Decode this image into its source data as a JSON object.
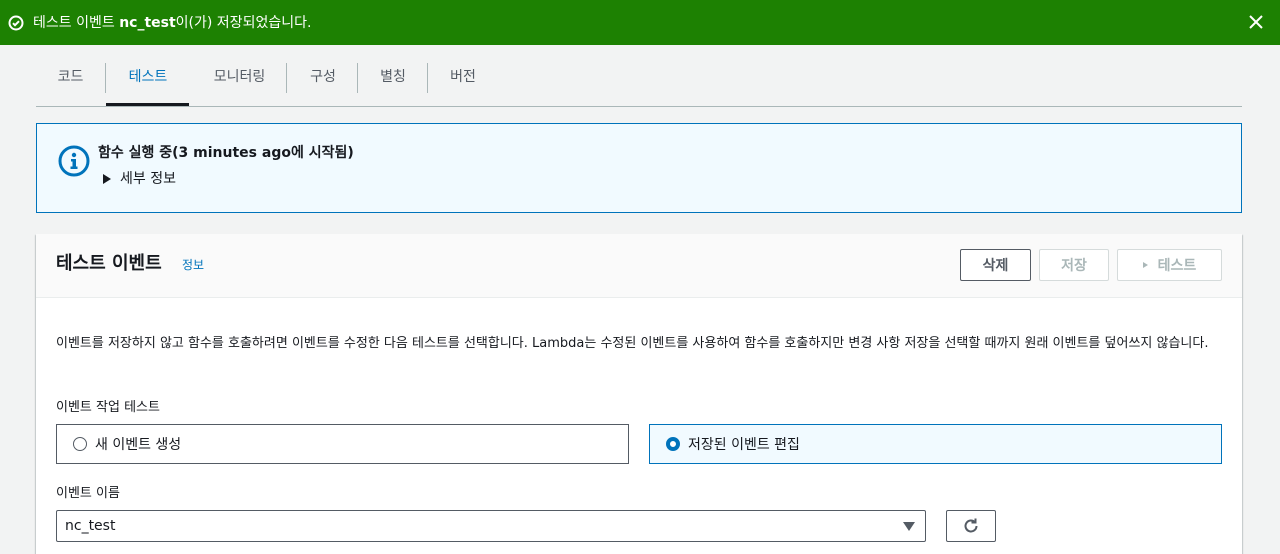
{
  "flash": {
    "prefix": "테스트 이벤트 ",
    "event_name": "nc_test",
    "suffix": "이(가) 저장되었습니다.",
    "color": "#1d8102"
  },
  "tabs": [
    {
      "label": "코드"
    },
    {
      "label": "테스트",
      "active": true
    },
    {
      "label": "모니터링"
    },
    {
      "label": "구성"
    },
    {
      "label": "별칭"
    },
    {
      "label": "버전"
    }
  ],
  "alert": {
    "title": "함수 실행 중(3 minutes ago에 시작됨)",
    "details_label": "세부 정보"
  },
  "panel": {
    "title": "테스트 이벤트",
    "info_link": "정보",
    "delete_button": "삭제",
    "save_button": "저장",
    "test_button": "테스트",
    "description": "이벤트를 저장하지 않고 함수를 호출하려면 이벤트를 수정한 다음 테스트를 선택합니다. Lambda는 수정된 이벤트를 사용하여 함수를 호출하지만 변경 사항 저장을 선택할 때까지 원래 이벤트를 덮어쓰지 않습니다.",
    "action_label": "이벤트 작업 테스트",
    "option_new": "새 이벤트 생성",
    "option_edit": "저장된 이벤트 편집",
    "selected_option": "저장된 이벤트 편집",
    "name_label": "이벤트 이름",
    "name_value": "nc_test"
  },
  "colors": {
    "accent": "#0073bb",
    "success": "#1d8102"
  }
}
